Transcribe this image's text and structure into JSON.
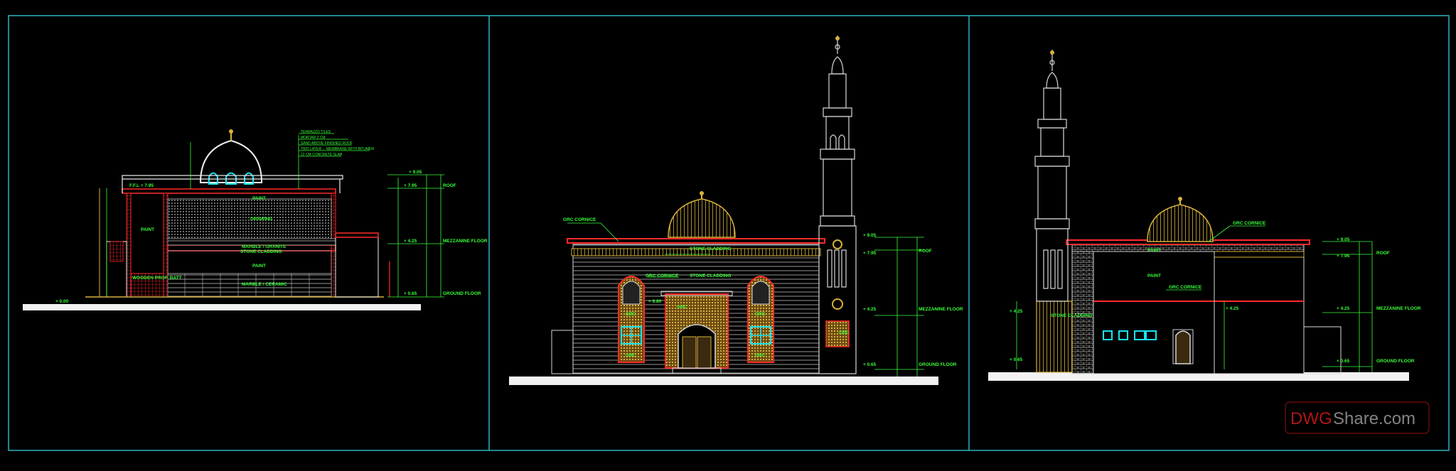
{
  "colors": {
    "background": "#000000",
    "frame": "#2fb3c2",
    "annotation": "#39ff39",
    "red_line": "#ff2a2a",
    "gold": "#d9b23a",
    "cyan_window": "#19e3ef",
    "white_line": "#d8d8d8",
    "watermark_red": "#d11a1a",
    "watermark_gray": "#9a9a9a"
  },
  "section": {
    "notes": [
      "TERRAZZO TILES",
      "MORTAR 2 CM",
      "SAND ABOVE FINISHED ROOF",
      "TWO LAYER ... MEMBRANE WITH BITUMEN",
      "12 CM CONCRETE SLAB"
    ],
    "labels": {
      "paint": "PAINT",
      "drawing": "DRAWING",
      "marble1": "MARBLE / GRANITE",
      "marble2": "STONE CLADDING",
      "wooden": "WOODEN PROF. BATT",
      "paint2": "PAINT",
      "marble3": "MARBLE / CERAMIC",
      "paint_left": "PAINT",
      "ffl": "F.F.L = 7.95"
    },
    "levels": [
      "+ 9.05",
      "+ 7.95",
      "+ 4.25",
      "+ 0.65",
      "+ 0.00"
    ],
    "level_names": [
      "ROOF",
      "MEZZANINE FLOOR",
      "GROUND FLOOR"
    ]
  },
  "front": {
    "labels": {
      "grc_cornice_top": "GRC CORNICE",
      "stone_cladding_top": "STONE CLADDING",
      "grc_cornice_mid": "GRC CORNICE",
      "stone_cladding_mid": "STONE CLADDING",
      "grc_center": "GRC",
      "grc_left": "GRC",
      "grc_right": "GRC",
      "grc_lower_left": "GRC",
      "grc_lower_right": "GRC",
      "grc_minaret": "GRC",
      "level_mid": "+ 6.80"
    },
    "levels": [
      "+ 9.05",
      "+ 7.95",
      "+ 4.25",
      "+ 0.65"
    ],
    "level_names": [
      "ROOF",
      "MEZZANINE FLOOR",
      "GROUND FLOOR"
    ]
  },
  "side": {
    "labels": {
      "grc_cornice_top": "GRC CORNICE",
      "paint_top": "PAINT",
      "paint_mid": "PAINT",
      "grc_cornice_mid": "GRC CORNICE",
      "stone_cladding": "STONE CLADDING",
      "level_left": "+ 4.25",
      "level_left2": "+ 0.65",
      "level_mid": "+ 4.25"
    },
    "levels": [
      "+ 9.05",
      "+ 7.95",
      "+ 4.25",
      "+ 0.65"
    ],
    "level_names": [
      "ROOF",
      "MEZZANINE FLOOR",
      "GROUND FLOOR"
    ]
  },
  "watermark": {
    "brand_part1": "DWG",
    "brand_part2": "Share.com"
  }
}
